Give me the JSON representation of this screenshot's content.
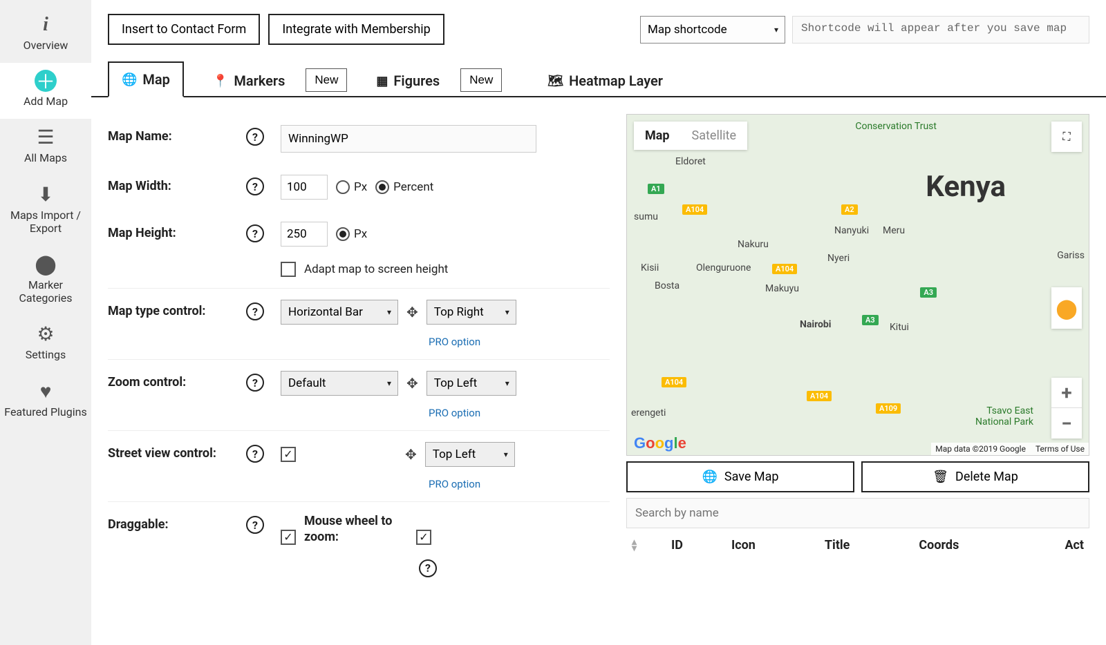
{
  "sidebar": {
    "items": [
      {
        "label": "Overview",
        "icon": "ℹ"
      },
      {
        "label": "Add Map",
        "icon": "＋",
        "active": true
      },
      {
        "label": "All Maps",
        "icon": "☰"
      },
      {
        "label": "Maps Import / Export",
        "icon": "⬇"
      },
      {
        "label": "Marker Categories",
        "icon": "📍"
      },
      {
        "label": "Settings",
        "icon": "⚙"
      },
      {
        "label": "Featured Plugins",
        "icon": "♥"
      }
    ]
  },
  "topbar": {
    "insert_contact": "Insert to Contact Form",
    "integrate_membership": "Integrate with Membership",
    "shortcode_select": "Map shortcode",
    "shortcode_placeholder": "Shortcode will appear after you save map"
  },
  "tabs": {
    "map": "Map",
    "markers": "Markers",
    "figures": "Figures",
    "heatmap": "Heatmap Layer",
    "new_btn": "New"
  },
  "form": {
    "map_name_label": "Map Name:",
    "map_name_value": "WinningWP",
    "map_width_label": "Map Width:",
    "map_width_value": "100",
    "px": "Px",
    "percent": "Percent",
    "map_height_label": "Map Height:",
    "map_height_value": "250",
    "adapt_label": "Adapt map to screen height",
    "map_type_label": "Map type control:",
    "map_type_value": "Horizontal Bar",
    "map_type_pos": "Top Right",
    "zoom_label": "Zoom control:",
    "zoom_value": "Default",
    "zoom_pos": "Top Left",
    "street_label": "Street view control:",
    "street_pos": "Top Left",
    "draggable_label": "Draggable:",
    "wheel_label": "Mouse wheel to zoom:",
    "pro_option": "PRO option"
  },
  "map": {
    "map_btn": "Map",
    "satellite_btn": "Satellite",
    "country": "Kenya",
    "cities": {
      "conservation": "Conservation Trust",
      "eldoret": "Eldoret",
      "isumu": "sumu",
      "nakuru": "Nakuru",
      "nanyuki": "Nanyuki",
      "meru": "Meru",
      "kisii": "Kisii",
      "olenguruone": "Olenguruone",
      "bosta": "Bosta",
      "nyeri": "Nyeri",
      "makuyu": "Makuyu",
      "nairobi": "Nairobi",
      "kitui": "Kitui",
      "gariss": "Gariss",
      "erengeti": "erengeti",
      "tsavo": "Tsavo East National Park"
    },
    "roads": {
      "a1": "A1",
      "a104_1": "A104",
      "a104_2": "A104",
      "a104_3": "A104",
      "a104_4": "A104",
      "a2": "A2",
      "a3_1": "A3",
      "a3_2": "A3",
      "a109": "A109"
    },
    "credits": "Map data ©2019 Google",
    "terms": "Terms of Use"
  },
  "actions": {
    "save": "Save Map",
    "delete": "Delete Map"
  },
  "table": {
    "search_placeholder": "Search by name",
    "col_id": "ID",
    "col_icon": "Icon",
    "col_title": "Title",
    "col_coords": "Coords",
    "col_act": "Act"
  }
}
